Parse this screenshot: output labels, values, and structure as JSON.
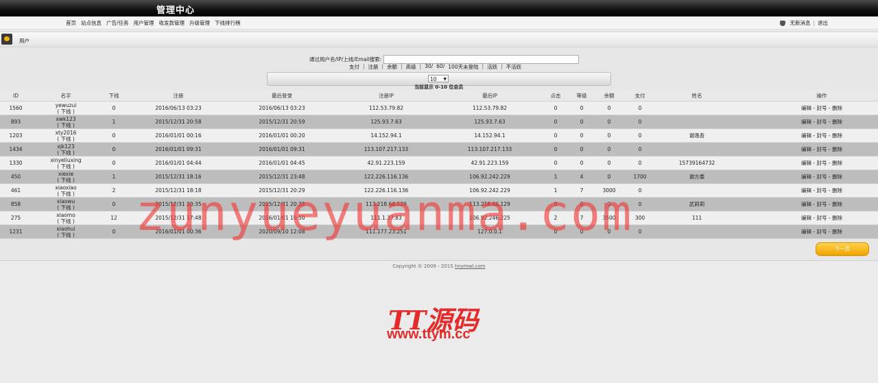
{
  "header": {
    "title": "管理中心"
  },
  "nav": {
    "links": [
      "首页",
      "站点信息",
      "广告/任务",
      "用户管理",
      "收发款管理",
      "升级管理",
      "下线排行榜"
    ],
    "messages": "无新消息",
    "separator": "|",
    "logout": "退出"
  },
  "panel": {
    "title": "用户"
  },
  "search": {
    "label": "通过用户名/IP/上线/Email搜索:",
    "value": ""
  },
  "filters": {
    "items": [
      "支付",
      "注册",
      "余额",
      "高级",
      "30/",
      "60/",
      "100天未登陆",
      "活跃",
      "不活跃"
    ],
    "separator": "|"
  },
  "pager": {
    "page_size": "10",
    "info": "当前显示 0-10 位会员"
  },
  "table": {
    "columns": [
      "ID",
      "名字",
      "下线",
      "注册",
      "最后登录",
      "注册IP",
      "最后IP",
      "点击",
      "等级",
      "余额",
      "支付",
      "姓名",
      "操作"
    ],
    "downline_text": "( 下线 )",
    "ops": {
      "edit": "编辑",
      "ban": "封号",
      "delete": "删除",
      "sep": "-"
    },
    "rows": [
      {
        "id": "1560",
        "name": "yewuzui",
        "downline": "0",
        "reg": "2016/06/13 03:23",
        "last": "2016/06/13 03:23",
        "reg_ip": "112.53.79.82",
        "last_ip": "112.53.79.82",
        "clicks": "0",
        "level": "0",
        "balance": "0",
        "paid": "0",
        "realname": ""
      },
      {
        "id": "893",
        "name": "xwk123",
        "downline": "1",
        "reg": "2015/12/31 20:58",
        "last": "2015/12/31 20:59",
        "reg_ip": "125.93.7.63",
        "last_ip": "125.93.7.63",
        "clicks": "0",
        "level": "0",
        "balance": "0",
        "paid": "0",
        "realname": ""
      },
      {
        "id": "1203",
        "name": "xty2016",
        "downline": "0",
        "reg": "2016/01/01 00:16",
        "last": "2016/01/01 00:20",
        "reg_ip": "14.152.94.1",
        "last_ip": "14.152.94.1",
        "clicks": "0",
        "level": "0",
        "balance": "0",
        "paid": "0",
        "realname": "谢逸吾"
      },
      {
        "id": "1434",
        "name": "xjk123",
        "downline": "0",
        "reg": "2016/01/01 09:31",
        "last": "2016/01/01 09:31",
        "reg_ip": "113.107.217.133",
        "last_ip": "113.107.217.133",
        "clicks": "0",
        "level": "0",
        "balance": "0",
        "paid": "0",
        "realname": ""
      },
      {
        "id": "1330",
        "name": "xinyeliuxing",
        "downline": "0",
        "reg": "2016/01/01 04:44",
        "last": "2016/01/01 04:45",
        "reg_ip": "42.91.223.159",
        "last_ip": "42.91.223.159",
        "clicks": "0",
        "level": "0",
        "balance": "0",
        "paid": "0",
        "realname": "15739164732"
      },
      {
        "id": "450",
        "name": "xiexie",
        "downline": "1",
        "reg": "2015/12/31 18:16",
        "last": "2015/12/31 23:48",
        "reg_ip": "122.226.116.136",
        "last_ip": "106.92.242.229",
        "clicks": "1",
        "level": "4",
        "balance": "0",
        "paid": "1700",
        "realname": "谢方委"
      },
      {
        "id": "461",
        "name": "xiaoxiao",
        "downline": "2",
        "reg": "2015/12/31 18:18",
        "last": "2015/12/31 20:29",
        "reg_ip": "122.226.116.136",
        "last_ip": "106.92.242.229",
        "clicks": "1",
        "level": "7",
        "balance": "3000",
        "paid": "0",
        "realname": ""
      },
      {
        "id": "858",
        "name": "xiaowu",
        "downline": "0",
        "reg": "2015/12/31 20:35",
        "last": "2015/12/31 20:35",
        "reg_ip": "113.218.66.129",
        "last_ip": "113.218.66.129",
        "clicks": "0",
        "level": "0",
        "balance": "0",
        "paid": "0",
        "realname": "武莉莉"
      },
      {
        "id": "275",
        "name": "xiaomo",
        "downline": "12",
        "reg": "2015/12/31 17:48",
        "last": "2016/01/01 10:50",
        "reg_ip": "111.1.37.83",
        "last_ip": "106.92.246.225",
        "clicks": "2",
        "level": "7",
        "balance": "3500",
        "paid": "300",
        "realname": "111"
      },
      {
        "id": "1231",
        "name": "xiaohui",
        "downline": "0",
        "reg": "2016/01/01 00:36",
        "last": "2020/09/10 12:08",
        "reg_ip": "111.177.23.251",
        "last_ip": "127.0.0.1",
        "clicks": "0",
        "level": "0",
        "balance": "0",
        "paid": "0",
        "realname": ""
      }
    ]
  },
  "next_page": "下一页",
  "footer": {
    "copyright": "Copyright © 2009 - 2015",
    "link": "hnymwl.com"
  },
  "watermark": "zunyueyuanma.com",
  "brand": {
    "logo_text": "TT源码",
    "url": "www.ttym.cc"
  },
  "colors": {
    "accent_button": "#f0a400",
    "watermark": "#f03c3c",
    "row_alt": "#bdbdbd"
  }
}
